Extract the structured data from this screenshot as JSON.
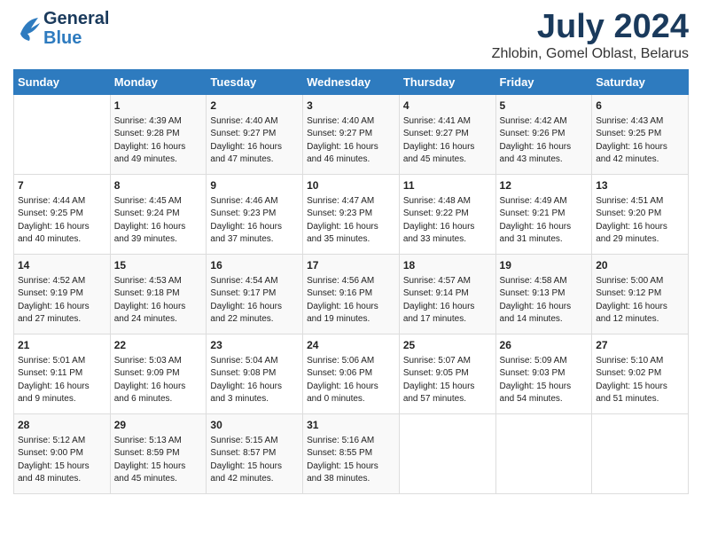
{
  "header": {
    "logo_line1": "General",
    "logo_line2": "Blue",
    "title": "July 2024",
    "location": "Zhlobin, Gomel Oblast, Belarus"
  },
  "days_of_week": [
    "Sunday",
    "Monday",
    "Tuesday",
    "Wednesday",
    "Thursday",
    "Friday",
    "Saturday"
  ],
  "weeks": [
    [
      {
        "day": "",
        "sunrise": "",
        "sunset": "",
        "daylight": ""
      },
      {
        "day": "1",
        "sunrise": "Sunrise: 4:39 AM",
        "sunset": "Sunset: 9:28 PM",
        "daylight": "Daylight: 16 hours and 49 minutes."
      },
      {
        "day": "2",
        "sunrise": "Sunrise: 4:40 AM",
        "sunset": "Sunset: 9:27 PM",
        "daylight": "Daylight: 16 hours and 47 minutes."
      },
      {
        "day": "3",
        "sunrise": "Sunrise: 4:40 AM",
        "sunset": "Sunset: 9:27 PM",
        "daylight": "Daylight: 16 hours and 46 minutes."
      },
      {
        "day": "4",
        "sunrise": "Sunrise: 4:41 AM",
        "sunset": "Sunset: 9:27 PM",
        "daylight": "Daylight: 16 hours and 45 minutes."
      },
      {
        "day": "5",
        "sunrise": "Sunrise: 4:42 AM",
        "sunset": "Sunset: 9:26 PM",
        "daylight": "Daylight: 16 hours and 43 minutes."
      },
      {
        "day": "6",
        "sunrise": "Sunrise: 4:43 AM",
        "sunset": "Sunset: 9:25 PM",
        "daylight": "Daylight: 16 hours and 42 minutes."
      }
    ],
    [
      {
        "day": "7",
        "sunrise": "Sunrise: 4:44 AM",
        "sunset": "Sunset: 9:25 PM",
        "daylight": "Daylight: 16 hours and 40 minutes."
      },
      {
        "day": "8",
        "sunrise": "Sunrise: 4:45 AM",
        "sunset": "Sunset: 9:24 PM",
        "daylight": "Daylight: 16 hours and 39 minutes."
      },
      {
        "day": "9",
        "sunrise": "Sunrise: 4:46 AM",
        "sunset": "Sunset: 9:23 PM",
        "daylight": "Daylight: 16 hours and 37 minutes."
      },
      {
        "day": "10",
        "sunrise": "Sunrise: 4:47 AM",
        "sunset": "Sunset: 9:23 PM",
        "daylight": "Daylight: 16 hours and 35 minutes."
      },
      {
        "day": "11",
        "sunrise": "Sunrise: 4:48 AM",
        "sunset": "Sunset: 9:22 PM",
        "daylight": "Daylight: 16 hours and 33 minutes."
      },
      {
        "day": "12",
        "sunrise": "Sunrise: 4:49 AM",
        "sunset": "Sunset: 9:21 PM",
        "daylight": "Daylight: 16 hours and 31 minutes."
      },
      {
        "day": "13",
        "sunrise": "Sunrise: 4:51 AM",
        "sunset": "Sunset: 9:20 PM",
        "daylight": "Daylight: 16 hours and 29 minutes."
      }
    ],
    [
      {
        "day": "14",
        "sunrise": "Sunrise: 4:52 AM",
        "sunset": "Sunset: 9:19 PM",
        "daylight": "Daylight: 16 hours and 27 minutes."
      },
      {
        "day": "15",
        "sunrise": "Sunrise: 4:53 AM",
        "sunset": "Sunset: 9:18 PM",
        "daylight": "Daylight: 16 hours and 24 minutes."
      },
      {
        "day": "16",
        "sunrise": "Sunrise: 4:54 AM",
        "sunset": "Sunset: 9:17 PM",
        "daylight": "Daylight: 16 hours and 22 minutes."
      },
      {
        "day": "17",
        "sunrise": "Sunrise: 4:56 AM",
        "sunset": "Sunset: 9:16 PM",
        "daylight": "Daylight: 16 hours and 19 minutes."
      },
      {
        "day": "18",
        "sunrise": "Sunrise: 4:57 AM",
        "sunset": "Sunset: 9:14 PM",
        "daylight": "Daylight: 16 hours and 17 minutes."
      },
      {
        "day": "19",
        "sunrise": "Sunrise: 4:58 AM",
        "sunset": "Sunset: 9:13 PM",
        "daylight": "Daylight: 16 hours and 14 minutes."
      },
      {
        "day": "20",
        "sunrise": "Sunrise: 5:00 AM",
        "sunset": "Sunset: 9:12 PM",
        "daylight": "Daylight: 16 hours and 12 minutes."
      }
    ],
    [
      {
        "day": "21",
        "sunrise": "Sunrise: 5:01 AM",
        "sunset": "Sunset: 9:11 PM",
        "daylight": "Daylight: 16 hours and 9 minutes."
      },
      {
        "day": "22",
        "sunrise": "Sunrise: 5:03 AM",
        "sunset": "Sunset: 9:09 PM",
        "daylight": "Daylight: 16 hours and 6 minutes."
      },
      {
        "day": "23",
        "sunrise": "Sunrise: 5:04 AM",
        "sunset": "Sunset: 9:08 PM",
        "daylight": "Daylight: 16 hours and 3 minutes."
      },
      {
        "day": "24",
        "sunrise": "Sunrise: 5:06 AM",
        "sunset": "Sunset: 9:06 PM",
        "daylight": "Daylight: 16 hours and 0 minutes."
      },
      {
        "day": "25",
        "sunrise": "Sunrise: 5:07 AM",
        "sunset": "Sunset: 9:05 PM",
        "daylight": "Daylight: 15 hours and 57 minutes."
      },
      {
        "day": "26",
        "sunrise": "Sunrise: 5:09 AM",
        "sunset": "Sunset: 9:03 PM",
        "daylight": "Daylight: 15 hours and 54 minutes."
      },
      {
        "day": "27",
        "sunrise": "Sunrise: 5:10 AM",
        "sunset": "Sunset: 9:02 PM",
        "daylight": "Daylight: 15 hours and 51 minutes."
      }
    ],
    [
      {
        "day": "28",
        "sunrise": "Sunrise: 5:12 AM",
        "sunset": "Sunset: 9:00 PM",
        "daylight": "Daylight: 15 hours and 48 minutes."
      },
      {
        "day": "29",
        "sunrise": "Sunrise: 5:13 AM",
        "sunset": "Sunset: 8:59 PM",
        "daylight": "Daylight: 15 hours and 45 minutes."
      },
      {
        "day": "30",
        "sunrise": "Sunrise: 5:15 AM",
        "sunset": "Sunset: 8:57 PM",
        "daylight": "Daylight: 15 hours and 42 minutes."
      },
      {
        "day": "31",
        "sunrise": "Sunrise: 5:16 AM",
        "sunset": "Sunset: 8:55 PM",
        "daylight": "Daylight: 15 hours and 38 minutes."
      },
      {
        "day": "",
        "sunrise": "",
        "sunset": "",
        "daylight": ""
      },
      {
        "day": "",
        "sunrise": "",
        "sunset": "",
        "daylight": ""
      },
      {
        "day": "",
        "sunrise": "",
        "sunset": "",
        "daylight": ""
      }
    ]
  ]
}
